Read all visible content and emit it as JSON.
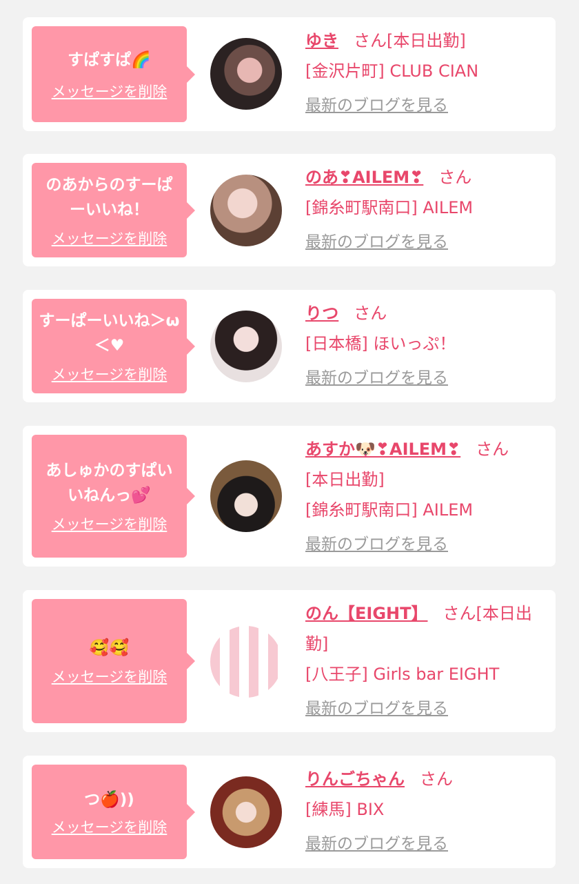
{
  "cards": [
    {
      "message": "すぱすぱ🌈",
      "delete_label": "メッセージを削除",
      "name": "ゆき",
      "honorific": "さん",
      "shop": "[本日出勤]",
      "location": "[金沢片町] CLUB CIAN",
      "blog_label": "最新のブログを見る"
    },
    {
      "message": "のあからのすーぱーいいね！",
      "delete_label": "メッセージを削除",
      "name": "のあ❣AILEM❣",
      "honorific": "さん",
      "shop": "",
      "location": "[錦糸町駅南口] AILEM",
      "blog_label": "最新のブログを見る"
    },
    {
      "message": "すーぱーいいね＞ω＜♥",
      "delete_label": "メッセージを削除",
      "name": "りつ",
      "honorific": "さん",
      "shop": "",
      "location": "[日本橋] ほいっぷ！",
      "blog_label": "最新のブログを見る"
    },
    {
      "message": "あしゅかのすぱいいねんっ💕",
      "delete_label": "メッセージを削除",
      "name": "あすか🐶❣AILEM❣",
      "honorific": "さん",
      "shop": "[本日出勤]",
      "location": "[錦糸町駅南口] AILEM",
      "blog_label": "最新のブログを見る"
    },
    {
      "message": "🥰🥰",
      "delete_label": "メッセージを削除",
      "name": "のん【EIGHT】",
      "honorific": "さん",
      "shop": "[本日出勤]",
      "location": "[八王子] Girls bar EIGHT",
      "blog_label": "最新のブログを見る"
    },
    {
      "message": "つ🍎))",
      "delete_label": "メッセージを削除",
      "name": "りんごちゃん",
      "honorific": "さん",
      "shop": "",
      "location": "[練馬] BIX",
      "blog_label": "最新のブログを見る"
    }
  ]
}
